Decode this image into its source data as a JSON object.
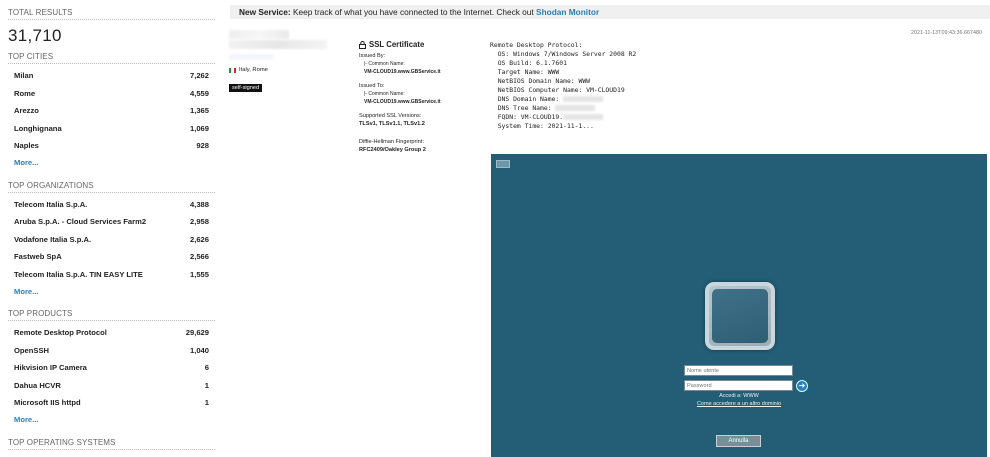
{
  "sidebar": {
    "total_title": "TOTAL RESULTS",
    "total_value": "31,710",
    "cities_title": "TOP CITIES",
    "cities": [
      {
        "label": "Milan",
        "value": "7,262"
      },
      {
        "label": "Rome",
        "value": "4,559"
      },
      {
        "label": "Arezzo",
        "value": "1,365"
      },
      {
        "label": "Longhignana",
        "value": "1,069"
      },
      {
        "label": "Naples",
        "value": "928"
      }
    ],
    "orgs_title": "TOP ORGANIZATIONS",
    "orgs": [
      {
        "label": "Telecom Italia S.p.A.",
        "value": "4,388"
      },
      {
        "label": "Aruba S.p.A. - Cloud Services Farm2",
        "value": "2,958"
      },
      {
        "label": "Vodafone Italia S.p.A.",
        "value": "2,626"
      },
      {
        "label": "Fastweb SpA",
        "value": "2,566"
      },
      {
        "label": "Telecom Italia S.p.A. TIN EASY LITE",
        "value": "1,555"
      }
    ],
    "products_title": "TOP PRODUCTS",
    "products": [
      {
        "label": "Remote Desktop Protocol",
        "value": "29,629"
      },
      {
        "label": "OpenSSH",
        "value": "1,040"
      },
      {
        "label": "Hikvision IP Camera",
        "value": "6"
      },
      {
        "label": "Dahua HCVR",
        "value": "1"
      },
      {
        "label": "Microsoft IIS httpd",
        "value": "1"
      }
    ],
    "os_title": "TOP OPERATING SYSTEMS",
    "more_label": "More..."
  },
  "banner": {
    "lead": "New Service:",
    "text": " Keep track of what you have connected to the Internet. Check out ",
    "link": "Shodan Monitor"
  },
  "timestamp": "2021-11-13T09:43:36.667480",
  "host": {
    "location": "Italy, Rome",
    "badge": "self-signed"
  },
  "ssl": {
    "title": "SSL Certificate",
    "issued_by": "Issued By:",
    "common_name": "|- Common Name:",
    "issued_by_cn": "VM-CLOUD19.www.GBService.it",
    "issued_to": "Issued To:",
    "issued_to_cn": "VM-CLOUD19.www.GBService.it",
    "versions_label": "Supported SSL Versions:",
    "versions": "TLSv1, TLSv1.1, TLSv1.2",
    "dh_label": "Diffie-Hellman Fingerprint:",
    "dh_value": "RFC2409/Oakley Group 2"
  },
  "rdp": {
    "l1": "Remote Desktop Protocol:",
    "l2": "  OS: Windows 7/Windows Server 2008 R2",
    "l3": "  OS Build: 6.1.7601",
    "l4": "  Target Name: WWW",
    "l5": "  NetBIOS Domain Name: WWW",
    "l6": "  NetBIOS Computer Name: VM-CLOUD19",
    "l7": "  DNS Domain Name:",
    "l8": "  DNS Tree Name:",
    "l9": "  FQDN: VM-CLOUD19.",
    "l10": "  System Time: 2021-11-1..."
  },
  "screenshot": {
    "username_placeholder": "Nome utente",
    "password_placeholder": "Password",
    "access_text": "Accedi a: WWW",
    "other_domain": "Come accedere a un altro dominio",
    "cancel": "Annulla"
  }
}
